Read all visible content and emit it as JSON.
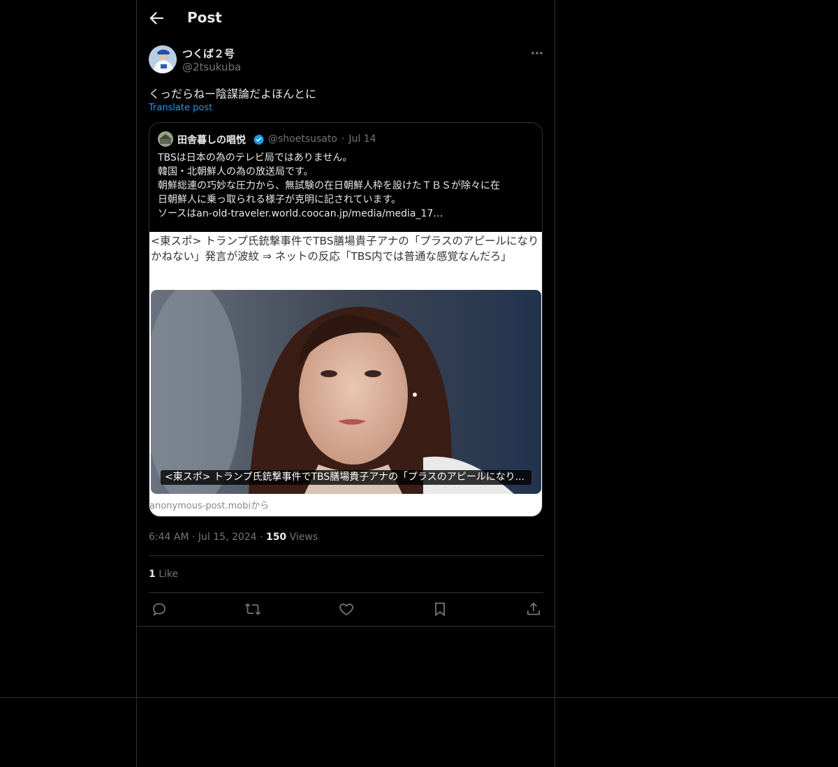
{
  "header": {
    "title": "Post"
  },
  "post": {
    "display_name": "つくば２号",
    "handle": "@2tsukuba",
    "text": "くっだらねー陰謀論だよほんとに",
    "translate_label": "Translate post",
    "time": "6:44 AM",
    "date": "Jul 15, 2024",
    "views_count": "150",
    "views_label": "Views",
    "likes_count": "1",
    "likes_label": "Like"
  },
  "quote": {
    "display_name": "田舎暮しの唱悦",
    "handle": "@shoetsusato",
    "date": "Jul 14",
    "lines": [
      "TBSは日本の為のテレビ局ではありません。",
      "韓国・北朝鮮人の為の放送局です。",
      " 朝鮮総連の巧妙な圧力から、無試験の在日朝鮮人枠を設けたＴＢＳが除々に在",
      "日朝鮮人に乗っ取られる様子が克明に記されています。",
      " ソースはan-old-traveler.world.coocan.jp/media/media_17…"
    ],
    "article_title": "<東スポ> トランプ氏銃撃事件でTBS膳場貴子アナの「プラスのアピールになりかねない」発言が波紋 ⇒ ネットの反応「TBS内では普通な感覚なんだろ」",
    "image_caption": "<東スポ> トランプ氏銃撃事件でTBS膳場貴子アナの「プラスのアピールになり...",
    "source": "anonymous-post.mobiから"
  },
  "icons": {
    "back": "arrow-left-icon",
    "more": "more-horizontal-icon",
    "verified": "verified-badge-icon",
    "reply": "reply-icon",
    "repost": "repost-icon",
    "like": "heart-icon",
    "bookmark": "bookmark-icon",
    "share": "share-icon"
  },
  "colors": {
    "accent": "#1d9bf0",
    "muted": "#71767b",
    "border": "#2f3336"
  }
}
